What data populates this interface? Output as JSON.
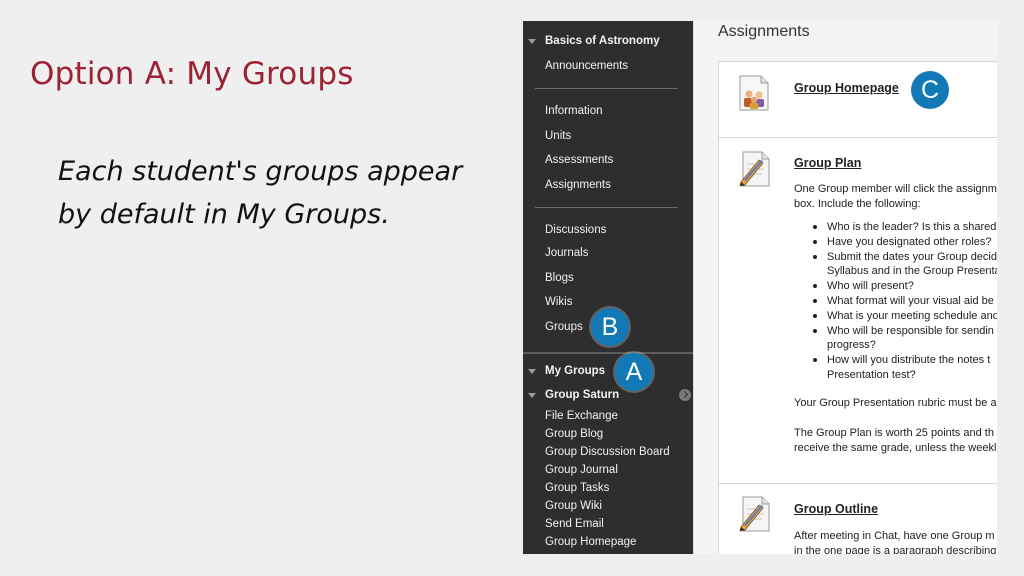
{
  "slide": {
    "title": "Option A: My Groups",
    "body_line1": "Each student's groups appear",
    "body_line2": "by default in My Groups."
  },
  "menu": {
    "course_title": "Basics of Astronomy",
    "items_top": [
      "Announcements"
    ],
    "items_mid": [
      "Information",
      "Units",
      "Assessments",
      "Assignments"
    ],
    "items_tools": [
      "Discussions",
      "Journals",
      "Blogs",
      "Wikis",
      "Groups"
    ],
    "my_groups": "My Groups",
    "group_name": "Group Saturn",
    "group_items": [
      "File Exchange",
      "Group Blog",
      "Group Discussion Board",
      "Group Journal",
      "Group Tasks",
      "Group Wiki",
      "Send Email",
      "Group Homepage"
    ]
  },
  "badges": {
    "a": "A",
    "b": "B",
    "c": "C"
  },
  "content": {
    "title": "Assignments",
    "items": [
      {
        "title": "Group Homepage",
        "icon": "group-people-icon"
      },
      {
        "title": "Group Plan",
        "icon": "assignment-pencil-icon",
        "intro1": "One Group member will click the assignm",
        "intro2": "box. Include the following:",
        "bullets": [
          "Who is the leader? Is this a shared",
          "Have you designated other roles?",
          "Submit the dates your Group decid",
          "Syllabus and in the Group Presenta",
          "Who will present?",
          "What format will your visual aid be",
          "What is your meeting schedule and",
          "Who will be responsible for sendin",
          "progress?",
          "How will you distribute the notes t",
          "Presentation test?"
        ],
        "rubric": "Your Group Presentation rubric must be a",
        "worth1": "The Group Plan is worth 25 points and th",
        "worth2": "receive the same grade, unless the weekl"
      },
      {
        "title": "Group Outline",
        "icon": "assignment-pencil-icon",
        "text1": "After meeting in Chat, have one Group m",
        "text2": "in the one page is a paragraph describing"
      }
    ]
  },
  "colors": {
    "title_red": "#9b2335",
    "badge_blue": "#1379b6",
    "menu_bg": "#2e2e2e"
  }
}
